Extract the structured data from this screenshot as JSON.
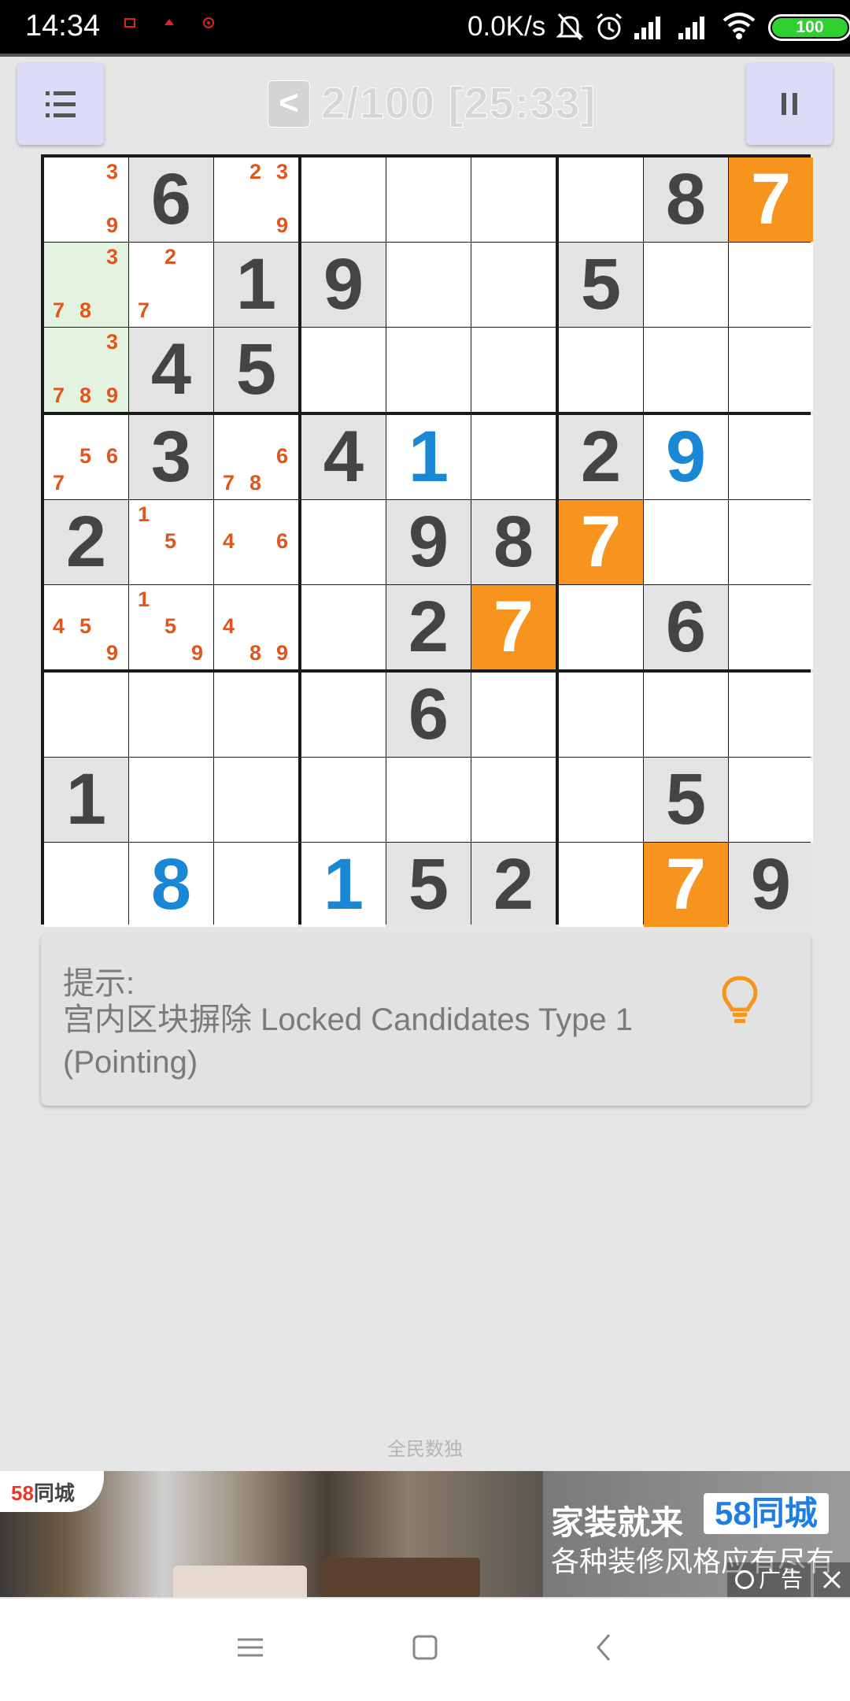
{
  "status_bar": {
    "time": "14:34",
    "net_speed": "0.0K/s",
    "battery": "100",
    "icons": [
      "mute-bell-icon",
      "alarm-icon",
      "signal-icon",
      "signal-icon",
      "wifi-icon",
      "battery-icon"
    ]
  },
  "header": {
    "back_label": "<",
    "title": "2/100 [25:33]",
    "menu_icon": "list-menu-icon",
    "pause_icon": "pause-icon"
  },
  "board": {
    "values": [
      [
        0,
        6,
        0,
        0,
        0,
        0,
        0,
        8,
        7
      ],
      [
        0,
        0,
        1,
        9,
        0,
        0,
        5,
        0,
        0
      ],
      [
        0,
        4,
        5,
        0,
        0,
        0,
        0,
        0,
        0
      ],
      [
        0,
        3,
        0,
        4,
        1,
        0,
        2,
        9,
        0
      ],
      [
        2,
        0,
        0,
        0,
        9,
        8,
        7,
        0,
        0
      ],
      [
        0,
        0,
        0,
        0,
        2,
        7,
        0,
        6,
        0
      ],
      [
        0,
        0,
        0,
        0,
        6,
        0,
        0,
        0,
        0
      ],
      [
        1,
        0,
        0,
        0,
        0,
        0,
        0,
        5,
        0
      ],
      [
        0,
        8,
        0,
        1,
        5,
        2,
        0,
        7,
        9
      ]
    ],
    "user_entered": [
      [
        3,
        4
      ],
      [
        3,
        7
      ],
      [
        8,
        1
      ],
      [
        8,
        3
      ]
    ],
    "highlight_orange": [
      [
        0,
        8
      ],
      [
        4,
        6
      ],
      [
        5,
        5
      ],
      [
        8,
        7
      ]
    ],
    "highlight_green": [
      [
        1,
        0
      ],
      [
        2,
        0
      ]
    ],
    "candidates": {
      "0,0": [
        3,
        9
      ],
      "0,2": [
        2,
        3,
        9
      ],
      "1,0": [
        3,
        7,
        8
      ],
      "1,1": [
        2,
        7
      ],
      "2,0": [
        3,
        7,
        8,
        9
      ],
      "3,0": [
        5,
        6,
        7
      ],
      "3,2": [
        6,
        7,
        8
      ],
      "4,1": [
        1,
        5
      ],
      "4,2": [
        4,
        6
      ],
      "5,0": [
        4,
        5,
        9
      ],
      "5,1": [
        1,
        5,
        9
      ],
      "5,2": [
        4,
        8,
        9
      ]
    }
  },
  "hint": {
    "label": "提示:",
    "text": "宫内区块摒除 Locked Candidates Type 1 (Pointing)",
    "icon": "lightbulb-icon"
  },
  "footer": {
    "brand": "全民数独"
  },
  "ad": {
    "logo_num": "58",
    "logo_text": "同城",
    "title": "家装就来",
    "brand": "58同城",
    "subtitle": "各种装修风格应有尽有",
    "tag": "广告"
  },
  "colors": {
    "orange": "#f7941d",
    "candidate": "#e0561c",
    "user_digit": "#1a87d5",
    "given_digit": "#444444",
    "green_cell": "#e4f3e0"
  }
}
